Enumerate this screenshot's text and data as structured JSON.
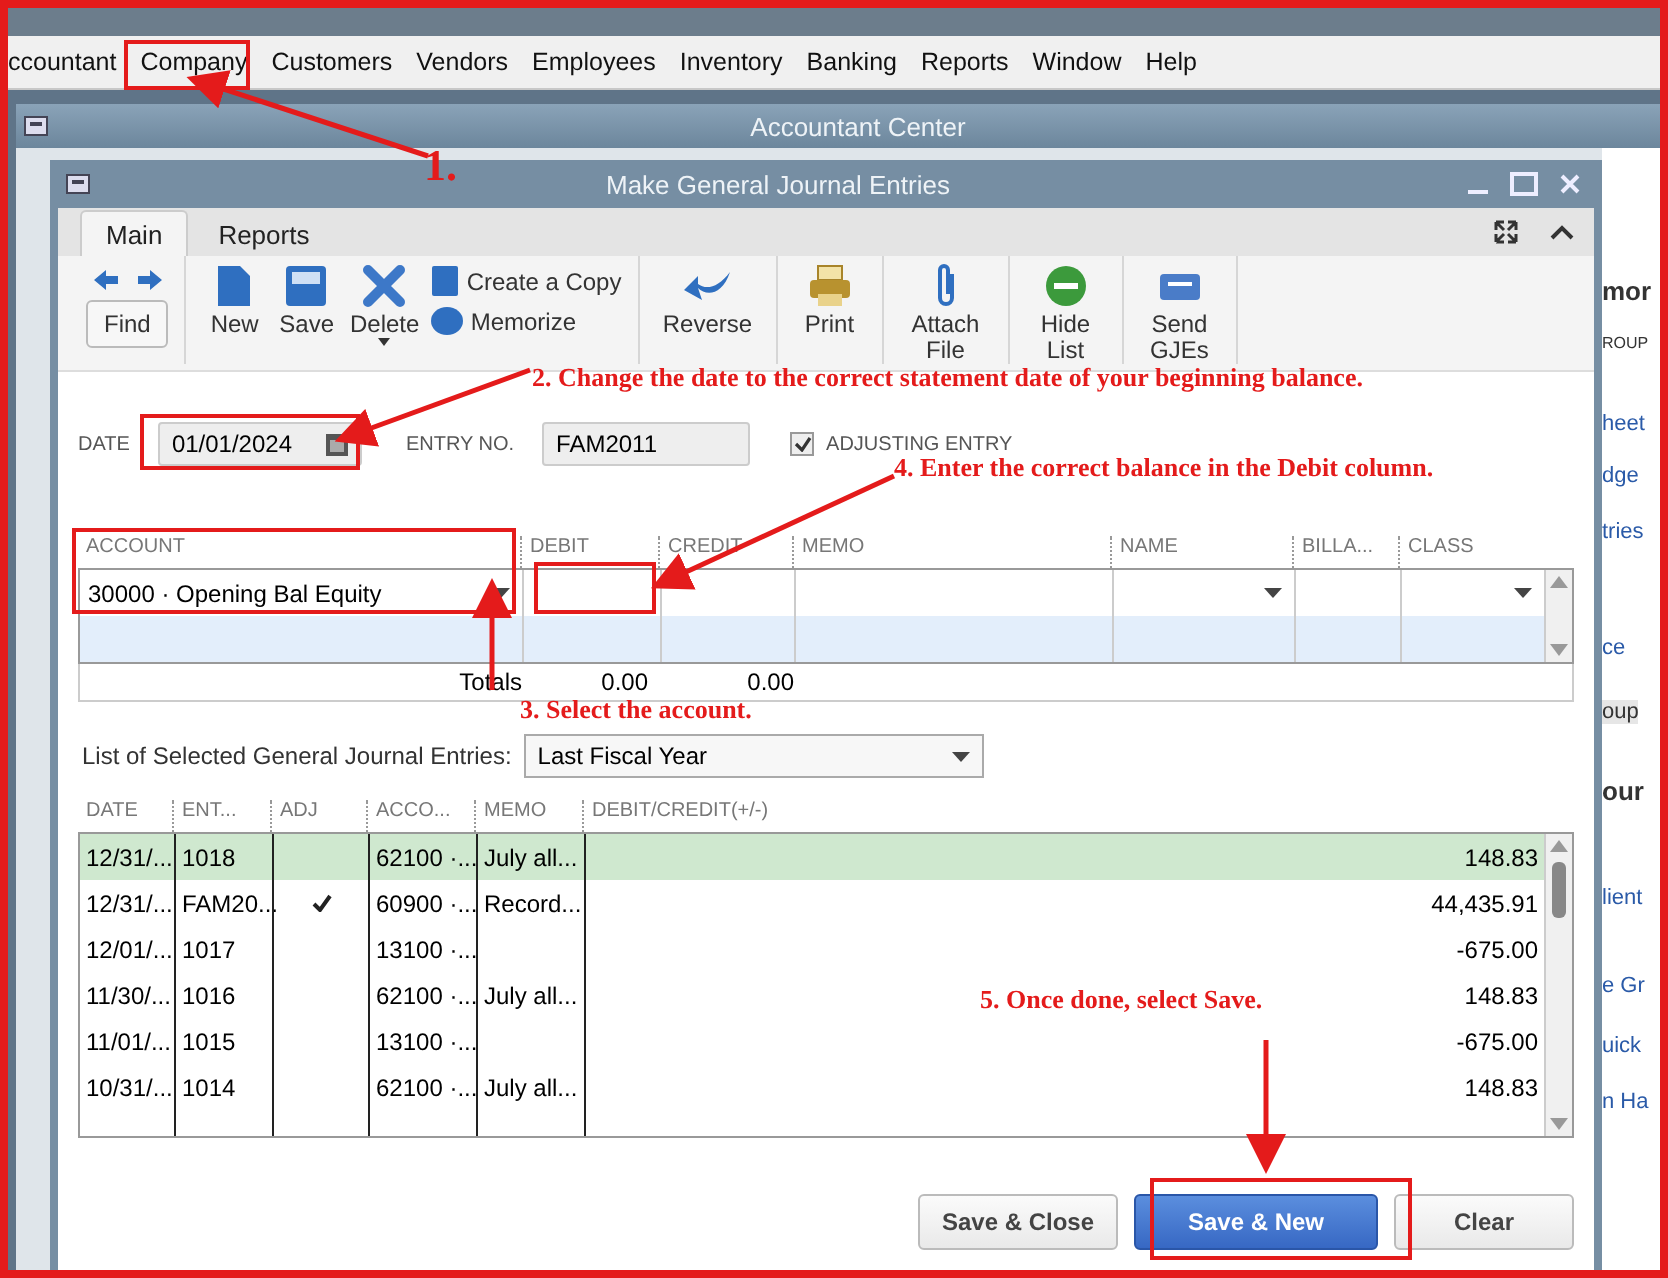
{
  "menu": [
    {
      "label": "ccountant",
      "selected": false
    },
    {
      "label": "Company",
      "selected": false
    },
    {
      "label": "Customers",
      "selected": false
    },
    {
      "label": "Vendors",
      "selected": false
    },
    {
      "label": "Employees",
      "selected": false
    },
    {
      "label": "Inventory",
      "selected": false
    },
    {
      "label": "Banking",
      "selected": false
    },
    {
      "label": "Reports",
      "selected": false
    },
    {
      "label": "Window",
      "selected": false
    },
    {
      "label": "Help",
      "selected": false
    }
  ],
  "outer_window": {
    "title": "Accountant Center"
  },
  "window": {
    "title": "Make General Journal Entries"
  },
  "tabs": [
    {
      "label": "Main",
      "selected": true
    },
    {
      "label": "Reports",
      "selected": false
    }
  ],
  "toolbar": [
    [
      {
        "kind": "find",
        "label": "Find"
      }
    ],
    [
      {
        "kind": "new",
        "label": "New"
      },
      {
        "kind": "save",
        "label": "Save"
      },
      {
        "kind": "delete",
        "label": "Delete"
      },
      {
        "kind": "stack",
        "items": [
          {
            "kind": "copy",
            "label": "Create a Copy"
          },
          {
            "kind": "memorize",
            "label": "Memorize"
          }
        ]
      }
    ],
    [
      {
        "kind": "reverse",
        "label": "Reverse"
      }
    ],
    [
      {
        "kind": "print",
        "label": "Print"
      }
    ],
    [
      {
        "kind": "attach",
        "label": "Attach File"
      }
    ],
    [
      {
        "kind": "hide",
        "label": "Hide List"
      }
    ],
    [
      {
        "kind": "send",
        "label": "Send GJEs"
      }
    ]
  ],
  "form": {
    "date_label": "DATE",
    "date": "01/01/2024",
    "entry_no_label": "ENTRY NO.",
    "entry_no": "FAM2011",
    "adjusting": {
      "label": "ADJUSTING ENTRY",
      "checked": true
    }
  },
  "entry_grid": {
    "columns": [
      "ACCOUNT",
      "DEBIT",
      "CREDIT",
      "MEMO",
      "NAME",
      "BILLA...",
      "CLASS"
    ],
    "rows": [
      {
        "account": "30000 · Opening Bal Equity"
      }
    ],
    "totals_label": "Totals",
    "totals": [
      "0.00",
      "0.00"
    ]
  },
  "list": {
    "label": "List of Selected General Journal Entries:",
    "filter": "Last Fiscal Year",
    "columns": [
      "DATE",
      "ENT...",
      "ADJ",
      "ACCO...",
      "MEMO",
      "DEBIT/CREDIT(+/-)"
    ],
    "rows": [
      {
        "date": "12/31/...",
        "entry": "1018",
        "adj": false,
        "account": "62100 ·...",
        "memo": "July all...",
        "amount": "148.83",
        "selected": true
      },
      {
        "date": "12/31/...",
        "entry": "FAM20...",
        "adj": true,
        "account": "60900 ·...",
        "memo": "Record...",
        "amount": "44,435.91",
        "selected": false
      },
      {
        "date": "12/01/...",
        "entry": "1017",
        "adj": false,
        "account": "13100 ·...",
        "memo": "",
        "amount": "-675.00",
        "selected": false
      },
      {
        "date": "11/30/...",
        "entry": "1016",
        "adj": false,
        "account": "62100 ·...",
        "memo": "July all...",
        "amount": "148.83",
        "selected": false
      },
      {
        "date": "11/01/...",
        "entry": "1015",
        "adj": false,
        "account": "13100 ·...",
        "memo": "",
        "amount": "-675.00",
        "selected": false
      },
      {
        "date": "10/31/...",
        "entry": "1014",
        "adj": false,
        "account": "62100 ·...",
        "memo": "July all...",
        "amount": "148.83",
        "selected": false
      }
    ]
  },
  "buttons": [
    {
      "label": "Save & Close",
      "kind": "default"
    },
    {
      "label": "Save & New",
      "kind": "primary"
    },
    {
      "label": "Clear",
      "kind": "default"
    }
  ],
  "side_panel": [
    {
      "text": "mor",
      "kind": "heading"
    },
    {
      "text": "ROUP",
      "kind": "caption"
    },
    {
      "text": "heet",
      "kind": "link"
    },
    {
      "text": "dge",
      "kind": "link"
    },
    {
      "text": "tries",
      "kind": "link"
    },
    {
      "text": "ce",
      "kind": "link"
    },
    {
      "text": "oup",
      "kind": "button"
    },
    {
      "text": "our",
      "kind": "heading"
    },
    {
      "text": "lient",
      "kind": "link"
    },
    {
      "text": "e Gr",
      "kind": "link"
    },
    {
      "text": "uick",
      "kind": "link"
    },
    {
      "text": "n Ha",
      "kind": "link"
    }
  ],
  "annotations": [
    {
      "text": "1."
    },
    {
      "text": "2. Change the date to the correct statement date of your beginning balance."
    },
    {
      "text": "3. Select the account."
    },
    {
      "text": "4. Enter the correct balance in the Debit column."
    },
    {
      "text": "5. Once done, select Save."
    }
  ]
}
